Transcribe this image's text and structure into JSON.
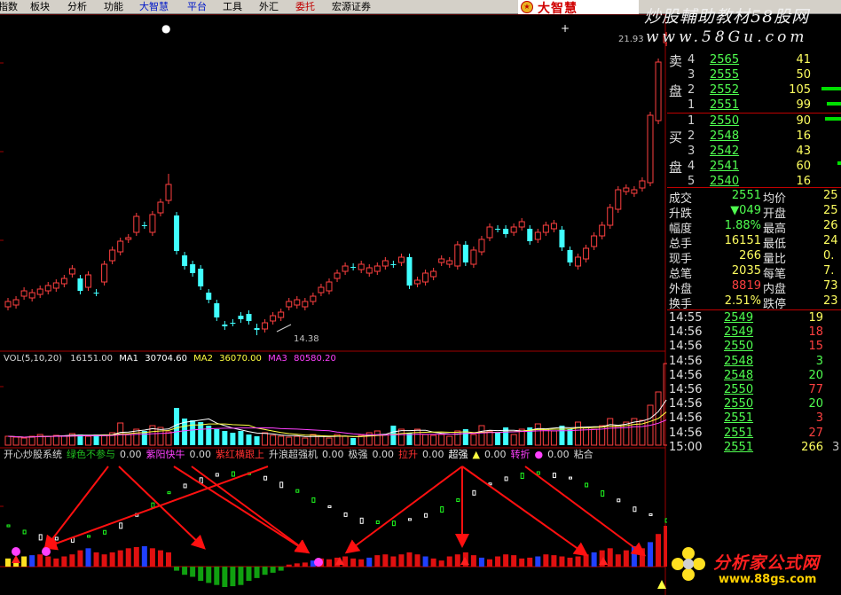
{
  "menu": [
    {
      "label": "指数",
      "color": "black"
    },
    {
      "label": "板块",
      "color": "black"
    },
    {
      "label": "分析",
      "color": "black"
    },
    {
      "label": "功能",
      "color": "black"
    },
    {
      "label": "大智慧",
      "color": "blue"
    },
    {
      "label": "平台",
      "color": "blue"
    },
    {
      "label": "工具",
      "color": "black"
    },
    {
      "label": "外汇",
      "color": "black"
    },
    {
      "label": "委托",
      "color": "red"
    },
    {
      "label": "宏源证券",
      "color": "black"
    }
  ],
  "brand_logo": "大智慧",
  "watermark": {
    "title": "炒股輔助教材58股网",
    "url": "www.58Gu.com"
  },
  "chart": {
    "high_label": "21.93",
    "low_label": "14.38",
    "vol_legend": {
      "name": "VOL(5,10,20)",
      "value": "16151.00",
      "ma1_label": "MA1",
      "ma1": "30704.60",
      "ma2_label": "MA2",
      "ma2": "36070.00",
      "ma3_label": "MA3",
      "ma3": "80580.20"
    },
    "indicator_legend": [
      {
        "text": "开心炒股系统",
        "color": "#d8d8d8"
      },
      {
        "text": "绿色不参与",
        "color": "#20c020"
      },
      {
        "text": "0.00",
        "color": "#d8d8d8"
      },
      {
        "text": "紫阳快牛",
        "color": "#ff40ff"
      },
      {
        "text": "0.00",
        "color": "#d8d8d8"
      },
      {
        "text": "紫红横跟上",
        "color": "#ff3030"
      },
      {
        "text": "升浪超强机",
        "color": "#d8d8d8"
      },
      {
        "text": "0.00",
        "color": "#d8d8d8"
      },
      {
        "text": "极强",
        "color": "#d8d8d8"
      },
      {
        "text": "0.00",
        "color": "#d8d8d8"
      },
      {
        "text": "拉升",
        "color": "#ff3030"
      },
      {
        "text": "0.00",
        "color": "#d8d8d8"
      },
      {
        "text": "超强",
        "color": "#ffffff"
      },
      {
        "text": "▲",
        "color": "#ffff40"
      },
      {
        "text": "0.00",
        "color": "#d8d8d8"
      },
      {
        "text": "转折",
        "color": "#ff40ff"
      },
      {
        "text": "●",
        "color": "#ff40ff"
      },
      {
        "text": "0.00",
        "color": "#d8d8d8"
      },
      {
        "text": "粘合",
        "color": "#d8d8d8"
      }
    ],
    "candles": [
      [
        346.0,
        340.0,
        336.0,
        350.0
      ],
      [
        344.0,
        338.0,
        334.0,
        348.0
      ],
      [
        334.0,
        328.0,
        324.0,
        338.0
      ],
      [
        336.0,
        330.0,
        326.0,
        340.0
      ],
      [
        332.0,
        326.0,
        322.0,
        336.0
      ],
      [
        328.0,
        322.0,
        318.0,
        332.0
      ],
      [
        325.0,
        319.0,
        315.0,
        329.0
      ],
      [
        320.0,
        314.0,
        310.0,
        324.0
      ],
      [
        309.0,
        303.0,
        299.0,
        313.0
      ],
      [
        314.0,
        328.0,
        310.0,
        332.0
      ],
      [
        324.0,
        310.0,
        306.0,
        328.0
      ],
      [
        330.0,
        330.0,
        326.0,
        334.0
      ],
      [
        318.0,
        298.0,
        294.0,
        322.0
      ],
      [
        294.0,
        282.0,
        278.0,
        298.0
      ],
      [
        284.0,
        272.0,
        268.0,
        288.0
      ],
      [
        270.0,
        268.0,
        264.0,
        274.0
      ],
      [
        262.0,
        244.0,
        240.0,
        266.0
      ],
      [
        254.0,
        254.0,
        250.0,
        258.0
      ],
      [
        262.0,
        242.0,
        238.0,
        266.0
      ],
      [
        240.0,
        228.0,
        224.0,
        244.0
      ],
      [
        226.0,
        208.0,
        196.0,
        230.0
      ],
      [
        243.0,
        283.0,
        239.0,
        287.0
      ],
      [
        288.0,
        300.0,
        284.0,
        304.0
      ],
      [
        298.0,
        308.0,
        294.0,
        312.0
      ],
      [
        303.0,
        323.0,
        299.0,
        327.0
      ],
      [
        330.0,
        338.0,
        326.0,
        342.0
      ],
      [
        342.0,
        358.0,
        338.0,
        362.0
      ],
      [
        366.0,
        368.0,
        362.0,
        372.0
      ],
      [
        364.0,
        364.0,
        360.0,
        368.0
      ],
      [
        356.0,
        360.0,
        352.0,
        364.0
      ],
      [
        354.0,
        362.0,
        350.0,
        366.0
      ],
      [
        370.0,
        372.0,
        365.0,
        378.0
      ],
      [
        371.0,
        364.0,
        360.0,
        375.0
      ],
      [
        362.0,
        356.0,
        352.0,
        366.0
      ],
      [
        358.0,
        352.0,
        348.0,
        362.0
      ],
      [
        346.0,
        340.0,
        336.0,
        350.0
      ],
      [
        344.0,
        338.0,
        334.0,
        348.0
      ],
      [
        346.0,
        340.0,
        336.0,
        350.0
      ],
      [
        340.0,
        334.0,
        330.0,
        344.0
      ],
      [
        330.0,
        324.0,
        320.0,
        334.0
      ],
      [
        328.0,
        318.0,
        314.0,
        332.0
      ],
      [
        314.0,
        308.0,
        304.0,
        318.0
      ],
      [
        306.0,
        300.0,
        296.0,
        310.0
      ],
      [
        301.0,
        301.0,
        297.0,
        305.0
      ],
      [
        304.0,
        298.0,
        294.0,
        308.0
      ],
      [
        308.0,
        302.0,
        298.0,
        312.0
      ],
      [
        306.0,
        300.0,
        296.0,
        310.0
      ],
      [
        300.0,
        294.0,
        290.0,
        304.0
      ],
      [
        298.0,
        298.0,
        294.0,
        302.0
      ],
      [
        296.0,
        290.0,
        286.0,
        300.0
      ],
      [
        290.0,
        322.0,
        286.0,
        326.0
      ],
      [
        320.0,
        316.0,
        312.0,
        324.0
      ],
      [
        318.0,
        308.0,
        304.0,
        322.0
      ],
      [
        312.0,
        306.0,
        302.0,
        316.0
      ],
      [
        296.0,
        292.0,
        288.0,
        300.0
      ],
      [
        298.0,
        294.0,
        290.0,
        302.0
      ],
      [
        300.0,
        276.0,
        272.0,
        304.0
      ],
      [
        276.0,
        296.0,
        272.0,
        300.0
      ],
      [
        298.0,
        282.0,
        278.0,
        302.0
      ],
      [
        284.0,
        270.0,
        266.0,
        288.0
      ],
      [
        268.0,
        256.0,
        252.0,
        272.0
      ],
      [
        258.0,
        258.0,
        254.0,
        262.0
      ],
      [
        258.0,
        264.0,
        254.0,
        268.0
      ],
      [
        262.0,
        256.0,
        252.0,
        266.0
      ],
      [
        256.0,
        250.0,
        246.0,
        260.0
      ],
      [
        258.0,
        272.0,
        254.0,
        276.0
      ],
      [
        270.0,
        262.0,
        258.0,
        274.0
      ],
      [
        262.0,
        254.0,
        250.0,
        266.0
      ],
      [
        258.0,
        252.0,
        248.0,
        262.0
      ],
      [
        259.0,
        279.0,
        255.0,
        283.0
      ],
      [
        282.0,
        296.0,
        278.0,
        300.0
      ],
      [
        300.0,
        290.0,
        286.0,
        304.0
      ],
      [
        292.0,
        280.0,
        276.0,
        296.0
      ],
      [
        278.0,
        266.0,
        262.0,
        282.0
      ],
      [
        266.0,
        254.0,
        250.0,
        270.0
      ],
      [
        254.0,
        234.0,
        230.0,
        258.0
      ],
      [
        236.0,
        214.0,
        210.0,
        240.0
      ],
      [
        216.0,
        212.0,
        208.0,
        220.0
      ],
      [
        218.0,
        214.0,
        210.0,
        222.0
      ],
      [
        212.0,
        204.0,
        200.0,
        216.0
      ],
      [
        206.0,
        130.0,
        126.0,
        210.0
      ],
      [
        136.0,
        70.0,
        66.0,
        140.0
      ],
      [
        48.0,
        40.0,
        36.0,
        52.0
      ]
    ],
    "volume": [
      0.1,
      0.09,
      0.08,
      0.1,
      0.12,
      0.1,
      0.11,
      0.1,
      0.13,
      0.12,
      0.1,
      0.12,
      0.11,
      0.14,
      0.25,
      0.12,
      0.18,
      0.16,
      0.22,
      0.2,
      0.15,
      0.42,
      0.3,
      0.28,
      0.26,
      0.22,
      0.18,
      0.16,
      0.14,
      0.16,
      0.12,
      0.1,
      0.14,
      0.11,
      0.1,
      0.09,
      0.1,
      0.08,
      0.12,
      0.1,
      0.08,
      0.12,
      0.1,
      0.08,
      0.11,
      0.14,
      0.16,
      0.12,
      0.22,
      0.18,
      0.14,
      0.18,
      0.12,
      0.11,
      0.12,
      0.1,
      0.16,
      0.18,
      0.12,
      0.22,
      0.16,
      0.14,
      0.2,
      0.12,
      0.18,
      0.2,
      0.24,
      0.18,
      0.16,
      0.22,
      0.18,
      0.26,
      0.2,
      0.18,
      0.22,
      0.3,
      0.22,
      0.26,
      0.3,
      0.28,
      0.45,
      0.6,
      0.92
    ],
    "histogram": [
      0.2,
      0.15,
      0.25,
      0.28,
      0.3,
      0.25,
      0.2,
      0.25,
      0.3,
      0.4,
      0.45,
      0.35,
      0.3,
      0.35,
      0.4,
      0.45,
      0.48,
      0.5,
      0.45,
      0.4,
      0.35,
      -0.1,
      -0.2,
      -0.25,
      -0.35,
      -0.4,
      -0.45,
      -0.5,
      -0.48,
      -0.45,
      -0.35,
      -0.28,
      -0.2,
      -0.15,
      -0.1,
      0.05,
      0.08,
      0.1,
      0.15,
      0.2,
      0.18,
      0.22,
      0.25,
      0.2,
      0.18,
      0.22,
      0.28,
      0.3,
      0.25,
      0.3,
      0.35,
      0.3,
      0.25,
      0.2,
      0.15,
      0.25,
      0.3,
      0.35,
      0.28,
      0.22,
      0.18,
      0.25,
      0.3,
      0.28,
      0.2,
      0.22,
      0.25,
      0.3,
      0.28,
      0.25,
      0.22,
      0.25,
      0.3,
      0.35,
      0.4,
      0.45,
      0.3,
      0.4,
      0.5,
      0.45,
      0.6,
      0.8,
      1.0
    ],
    "annotation_tags": [
      "绿色不参与",
      "紫阳快牛",
      "紫红横跟上",
      "拉升",
      "超强"
    ]
  },
  "orderbook": {
    "sell_caption": [
      "卖",
      "盘"
    ],
    "buy_caption": [
      "买",
      "盘"
    ],
    "sell": [
      {
        "level": "4",
        "price": "2565",
        "vol": "41"
      },
      {
        "level": "3",
        "price": "2555",
        "vol": "50"
      },
      {
        "level": "2",
        "price": "2552",
        "vol": "105"
      },
      {
        "level": "1",
        "price": "2551",
        "vol": "99"
      }
    ],
    "buy": [
      {
        "level": "1",
        "price": "2550",
        "vol": "90"
      },
      {
        "level": "2",
        "price": "2548",
        "vol": "16"
      },
      {
        "level": "3",
        "price": "2542",
        "vol": "43"
      },
      {
        "level": "4",
        "price": "2541",
        "vol": "60"
      },
      {
        "level": "5",
        "price": "2540",
        "vol": "16"
      }
    ]
  },
  "stats": [
    {
      "l1": "成交",
      "v1": "2551",
      "c1": "#50ff50",
      "l2": "均价",
      "v2": "25"
    },
    {
      "l1": "升跌",
      "v1": "▼049",
      "c1": "#50ff50",
      "l2": "开盘",
      "v2": "25"
    },
    {
      "l1": "幅度",
      "v1": "1.88%",
      "c1": "#50ff50",
      "l2": "最高",
      "v2": "26"
    },
    {
      "l1": "总手",
      "v1": "16151",
      "c1": "#ffff60",
      "l2": "最低",
      "v2": "24"
    },
    {
      "l1": "现手",
      "v1": "266",
      "c1": "#ffff60",
      "l2": "量比",
      "v2": "0."
    },
    {
      "l1": "总笔",
      "v1": "2035",
      "c1": "#ffff60",
      "l2": "每笔",
      "v2": "7."
    },
    {
      "l1": "外盘",
      "v1": "8819",
      "c1": "#ff4040",
      "l2": "内盘",
      "v2": "73"
    },
    {
      "l1": "换手",
      "v1": "2.51%",
      "c1": "#ffff60",
      "l2": "跌停",
      "v2": "23"
    }
  ],
  "ticks": [
    {
      "time": "14:55",
      "price": "2549",
      "vol": "19",
      "vc": "#ffff60",
      "x": ""
    },
    {
      "time": "14:56",
      "price": "2549",
      "vol": "18",
      "vc": "#ff4040",
      "x": ""
    },
    {
      "time": "14:56",
      "price": "2550",
      "vol": "15",
      "vc": "#ff4040",
      "x": ""
    },
    {
      "time": "14:56",
      "price": "2548",
      "vol": "3",
      "vc": "#50ff50",
      "x": ""
    },
    {
      "time": "14:56",
      "price": "2548",
      "vol": "20",
      "vc": "#50ff50",
      "x": ""
    },
    {
      "time": "14:56",
      "price": "2550",
      "vol": "77",
      "vc": "#ff4040",
      "x": ""
    },
    {
      "time": "14:56",
      "price": "2550",
      "vol": "20",
      "vc": "#50ff50",
      "x": ""
    },
    {
      "time": "14:56",
      "price": "2551",
      "vol": "3",
      "vc": "#ff4040",
      "x": ""
    },
    {
      "time": "14:56",
      "price": "2551",
      "vol": "27",
      "vc": "#ff4040",
      "x": ""
    },
    {
      "time": "15:00",
      "price": "2551",
      "vol": "266",
      "vc": "#ffff60",
      "x": "3"
    }
  ],
  "bottom_logo": {
    "title": "分析家公式网",
    "url": "www.88gs.com"
  }
}
